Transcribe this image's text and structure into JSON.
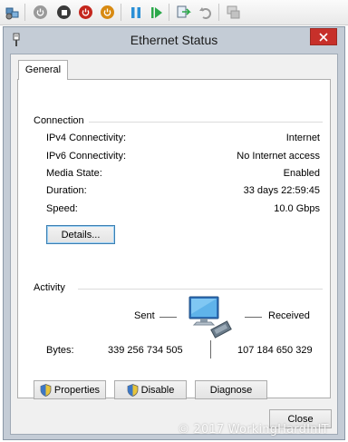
{
  "window": {
    "title": "Ethernet Status"
  },
  "tabs": [
    {
      "label": "General",
      "selected": true
    }
  ],
  "connection": {
    "group_label": "Connection",
    "rows": [
      {
        "label": "IPv4 Connectivity:",
        "value": "Internet"
      },
      {
        "label": "IPv6 Connectivity:",
        "value": "No Internet access"
      },
      {
        "label": "Media State:",
        "value": "Enabled"
      },
      {
        "label": "Duration:",
        "value": "33 days 22:59:45"
      },
      {
        "label": "Speed:",
        "value": "10.0 Gbps"
      }
    ],
    "details_button": "Details..."
  },
  "activity": {
    "group_label": "Activity",
    "sent_label": "Sent",
    "received_label": "Received",
    "bytes_label": "Bytes:",
    "bytes_sent": "339 256 734 505",
    "bytes_received": "107 184 650 329"
  },
  "buttons": {
    "properties": "Properties",
    "disable": "Disable",
    "diagnose": "Diagnose",
    "close": "Close"
  },
  "watermark": "© 2017 WorkingHardInIT",
  "icons": {
    "toolbar": [
      "vm-settings-icon",
      "power-off-icon",
      "stop-icon",
      "shutdown-icon",
      "power-button-icon",
      "pause-icon",
      "start-icon",
      "checkpoint-icon",
      "revert-icon",
      "enhanced-session-icon"
    ],
    "title": "ethernet-adapter-icon",
    "activity": "network-computer-icon"
  }
}
